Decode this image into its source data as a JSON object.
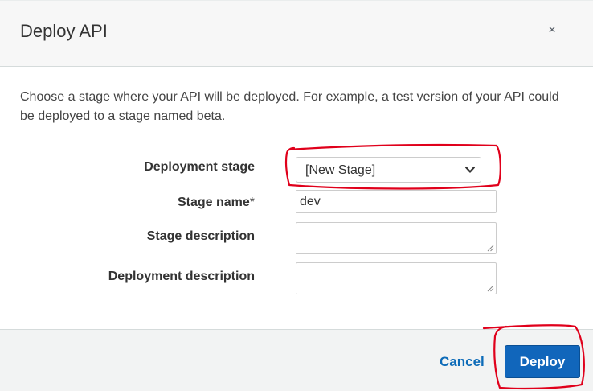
{
  "dialog": {
    "title": "Deploy API",
    "close_glyph": "×",
    "description": "Choose a stage where your API will be deployed. For example, a test version of your API could be deployed to a stage named beta."
  },
  "form": {
    "deployment_stage": {
      "label": "Deployment stage",
      "selected_value": "[New Stage]",
      "icon": "chevron-down-icon"
    },
    "stage_name": {
      "label": "Stage name",
      "required_marker": "*",
      "value": "dev"
    },
    "stage_description": {
      "label": "Stage description",
      "value": ""
    },
    "deployment_description": {
      "label": "Deployment description",
      "value": ""
    }
  },
  "footer": {
    "cancel_label": "Cancel",
    "deploy_label": "Deploy"
  },
  "colors": {
    "primary_button": "#1166bb",
    "link": "#0d6bb8",
    "annotation": "#e0001b"
  }
}
